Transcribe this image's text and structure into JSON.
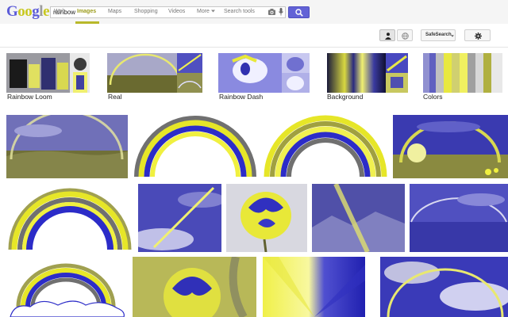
{
  "logo": {
    "letters": [
      "G",
      "o",
      "o",
      "g",
      "l",
      "e"
    ],
    "colors": [
      "#5c5cd8",
      "#c8c81e",
      "#c8c81e",
      "#5c5cd8",
      "#9c9c9c",
      "#c8c81e"
    ]
  },
  "search": {
    "value": "rainbow"
  },
  "nav": {
    "items": [
      "Web",
      "Images",
      "Maps",
      "Shopping",
      "Videos",
      "More",
      "Search tools"
    ],
    "active": "Images"
  },
  "tools": {
    "safesearch_label": "SafeSearch"
  },
  "related": [
    {
      "label": "Rainbow Loom"
    },
    {
      "label": "Real"
    },
    {
      "label": "Rainbow Dash"
    },
    {
      "label": "Background"
    },
    {
      "label": "Colors"
    }
  ],
  "colors": {
    "accent_blue": "#6262d6",
    "accent_yellow": "#b8b82a",
    "arc_yellow": "#e6e628",
    "arc_blue": "#2c2cc8",
    "arc_gray": "#707070"
  }
}
